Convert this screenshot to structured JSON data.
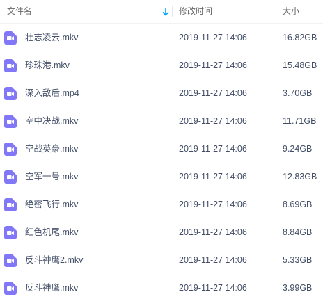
{
  "header": {
    "name_label": "文件名",
    "modified_label": "修改时间",
    "size_label": "大小",
    "sort_icon": "sort-down-arrow-icon"
  },
  "colors": {
    "accent": "#06a7ff",
    "video_icon": "#8278f7",
    "text": "#424e67",
    "header_text": "#666666"
  },
  "files": [
    {
      "name": "壮志凌云.mkv",
      "modified": "2019-11-27 14:06",
      "size": "16.82GB",
      "icon": "video-file-icon"
    },
    {
      "name": "珍珠港.mkv",
      "modified": "2019-11-27 14:06",
      "size": "15.48GB",
      "icon": "video-file-icon"
    },
    {
      "name": "深入敌后.mp4",
      "modified": "2019-11-27 14:06",
      "size": "3.70GB",
      "icon": "video-file-icon"
    },
    {
      "name": "空中决战.mkv",
      "modified": "2019-11-27 14:06",
      "size": "11.71GB",
      "icon": "video-file-icon"
    },
    {
      "name": "空战英豪.mkv",
      "modified": "2019-11-27 14:06",
      "size": "9.24GB",
      "icon": "video-file-icon"
    },
    {
      "name": "空军一号.mkv",
      "modified": "2019-11-27 14:06",
      "size": "12.83GB",
      "icon": "video-file-icon"
    },
    {
      "name": "绝密飞行.mkv",
      "modified": "2019-11-27 14:06",
      "size": "8.69GB",
      "icon": "video-file-icon"
    },
    {
      "name": "红色机尾.mkv",
      "modified": "2019-11-27 14:06",
      "size": "8.84GB",
      "icon": "video-file-icon"
    },
    {
      "name": "反斗神鹰2.mkv",
      "modified": "2019-11-27 14:06",
      "size": "5.33GB",
      "icon": "video-file-icon"
    },
    {
      "name": "反斗神鹰.mkv",
      "modified": "2019-11-27 14:06",
      "size": "3.99GB",
      "icon": "video-file-icon"
    }
  ]
}
